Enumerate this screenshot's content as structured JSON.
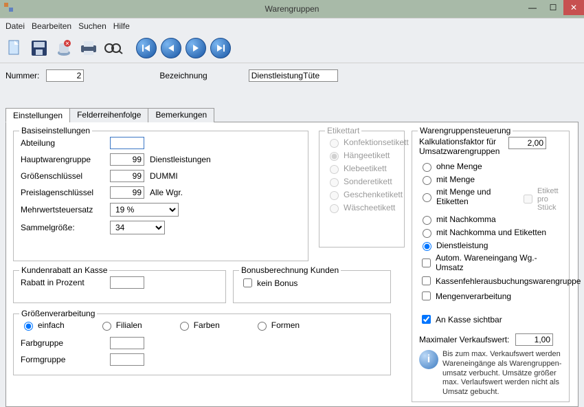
{
  "window": {
    "title": "Warengruppen"
  },
  "menu": {
    "datei": "Datei",
    "bearbeiten": "Bearbeiten",
    "suchen": "Suchen",
    "hilfe": "Hilfe"
  },
  "header": {
    "nummer_label": "Nummer:",
    "nummer_value": "2",
    "bezeichnung_label": "Bezeichnung",
    "bezeichnung_value": "DienstleistungTüte"
  },
  "tabs": {
    "einstellungen": "Einstellungen",
    "felderreihenfolge": "Felderreihenfolge",
    "bemerkungen": "Bemerkungen"
  },
  "basis": {
    "legend": "Basiseinstellungen",
    "abteilung_label": "Abteilung",
    "abteilung_value": "",
    "hauptwg_label": "Hauptwarengruppe",
    "hauptwg_value": "99",
    "hauptwg_after": "Dienstleistungen",
    "groessen_label": "Größenschlüssel",
    "groessen_value": "99",
    "groessen_after": "DUMMI",
    "preis_label": "Preislagenschlüssel",
    "preis_value": "99",
    "preis_after": "Alle Wgr.",
    "mwst_label": "Mehrwertsteuersatz",
    "mwst_value": "19 %",
    "sammel_label": "Sammelgröße:",
    "sammel_value": "34"
  },
  "kunden": {
    "legend": "Kundenrabatt an Kasse",
    "rabatt_label": "Rabatt in Prozent",
    "rabatt_value": ""
  },
  "bonus": {
    "legend": "Bonusberechnung Kunden",
    "kein_bonus": "kein Bonus"
  },
  "groessenv": {
    "legend": "Größenverarbeitung",
    "einfach": "einfach",
    "filialen": "Filialen",
    "farben": "Farben",
    "formen": "Formen",
    "farbgruppe_label": "Farbgruppe",
    "farbgruppe_value": "",
    "formgruppe_label": "Formgruppe",
    "formgruppe_value": ""
  },
  "etikett": {
    "legend": "Etikettart",
    "konfektion": "Konfektionsetikett",
    "haenge": "Hängeetikett",
    "klebe": "Klebeetikett",
    "sonder": "Sonderetikett",
    "geschenk": "Geschenketikett",
    "waesche": "Wäscheetikett"
  },
  "steuerung": {
    "legend": "Warengruppensteuerung",
    "kalk_label": "Kalkulationsfaktor für Umsatzwarengruppen",
    "kalk_value": "2,00",
    "ohne_menge": "ohne Menge",
    "mit_menge": "mit Menge",
    "mit_menge_etiketten": "mit Menge und Etiketten",
    "etikett_pro_stueck": "Etikett pro Stück",
    "mit_nachkomma": "mit Nachkomma",
    "mit_nachkomma_etiketten": "mit Nachkomma und Etiketten",
    "dienstleistung": "Dienstleistung",
    "autom_we": "Autom. Wareneingang Wg.-Umsatz",
    "kassenfehler": "Kassenfehlerausbuchungswarengruppe",
    "mengenv": "Mengenverarbeitung",
    "an_kasse": "An Kasse sichtbar",
    "max_label": "Maximaler Verkaufswert:",
    "max_value": "1,00",
    "info": "Bis zum max. Verkaufswert werden Wareneingänge als Warengruppen-umsatz verbucht. Umsätze größer max. Verlaufswert werden nicht als Umsatz gebucht."
  }
}
